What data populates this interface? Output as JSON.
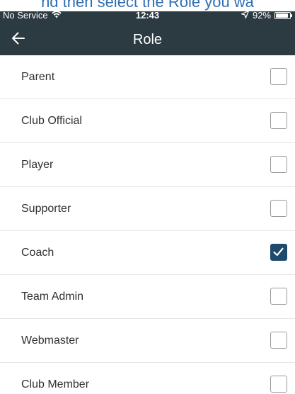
{
  "caption": "nd then select the Role you wa",
  "status_bar": {
    "carrier": "No Service",
    "time": "12:43",
    "battery_pct": "92%"
  },
  "nav": {
    "title": "Role",
    "back_icon": "arrow-left-icon"
  },
  "roles": [
    {
      "label": "Parent",
      "checked": false
    },
    {
      "label": "Club Official",
      "checked": false
    },
    {
      "label": "Player",
      "checked": false
    },
    {
      "label": "Supporter",
      "checked": false
    },
    {
      "label": "Coach",
      "checked": true
    },
    {
      "label": "Team Admin",
      "checked": false
    },
    {
      "label": "Webmaster",
      "checked": false
    },
    {
      "label": "Club Member",
      "checked": false
    }
  ],
  "colors": {
    "appbar": "#2c3a41",
    "checked": "#1f4a6e",
    "caption": "#2f6fb3"
  },
  "battery_level": 0.92
}
